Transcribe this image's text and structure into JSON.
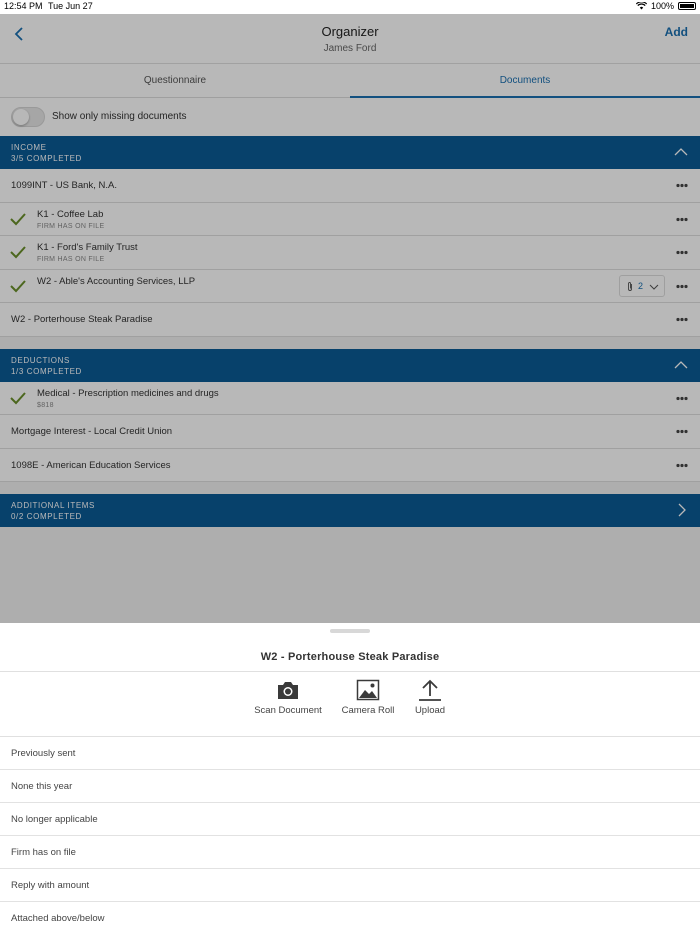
{
  "status_bar": {
    "time": "12:54 PM",
    "date": "Tue Jun 27",
    "battery": "100%"
  },
  "nav": {
    "title": "Organizer",
    "subtitle": "James Ford",
    "add_label": "Add"
  },
  "tabs": [
    {
      "label": "Questionnaire",
      "active": false
    },
    {
      "label": "Documents",
      "active": true
    }
  ],
  "toggle": {
    "label": "Show only missing documents",
    "on": false
  },
  "sections": [
    {
      "title": "INCOME",
      "count": "3/5 COMPLETED",
      "items": [
        {
          "title": "1099INT - US Bank, N.A.",
          "sub": "",
          "checked": false
        },
        {
          "title": "K1 - Coffee Lab",
          "sub": "FIRM HAS ON FILE",
          "checked": true
        },
        {
          "title": "K1 - Ford's Family Trust",
          "sub": "FIRM HAS ON FILE",
          "checked": true
        },
        {
          "title": "W2 - Able's Accounting Services, LLP",
          "sub": "",
          "checked": true,
          "attachments": "2"
        },
        {
          "title": "W2 - Porterhouse Steak Paradise",
          "sub": "",
          "checked": false
        }
      ]
    },
    {
      "title": "DEDUCTIONS",
      "count": "1/3 COMPLETED",
      "items": [
        {
          "title": "Medical - Prescription medicines and drugs",
          "sub": "$818",
          "checked": true
        },
        {
          "title": "Mortgage Interest - Local Credit Union",
          "sub": "",
          "checked": false
        },
        {
          "title": "1098E - American Education Services",
          "sub": "",
          "checked": false
        }
      ]
    },
    {
      "title": "ADDITIONAL ITEMS",
      "count": "0/2 COMPLETED",
      "items": []
    }
  ],
  "sheet": {
    "title": "W2 - Porterhouse Steak Paradise",
    "actions": [
      {
        "label": "Scan Document",
        "icon": "camera-icon"
      },
      {
        "label": "Camera Roll",
        "icon": "photo-icon"
      },
      {
        "label": "Upload",
        "icon": "upload-icon"
      }
    ],
    "options": [
      "Previously sent",
      "None this year",
      "No longer applicable",
      "Firm has on file",
      "Reply with amount",
      "Attached above/below"
    ]
  },
  "colors": {
    "accent": "#1a6fb0",
    "section_bg": "#0a5a95",
    "check": "#6a8f2a"
  }
}
